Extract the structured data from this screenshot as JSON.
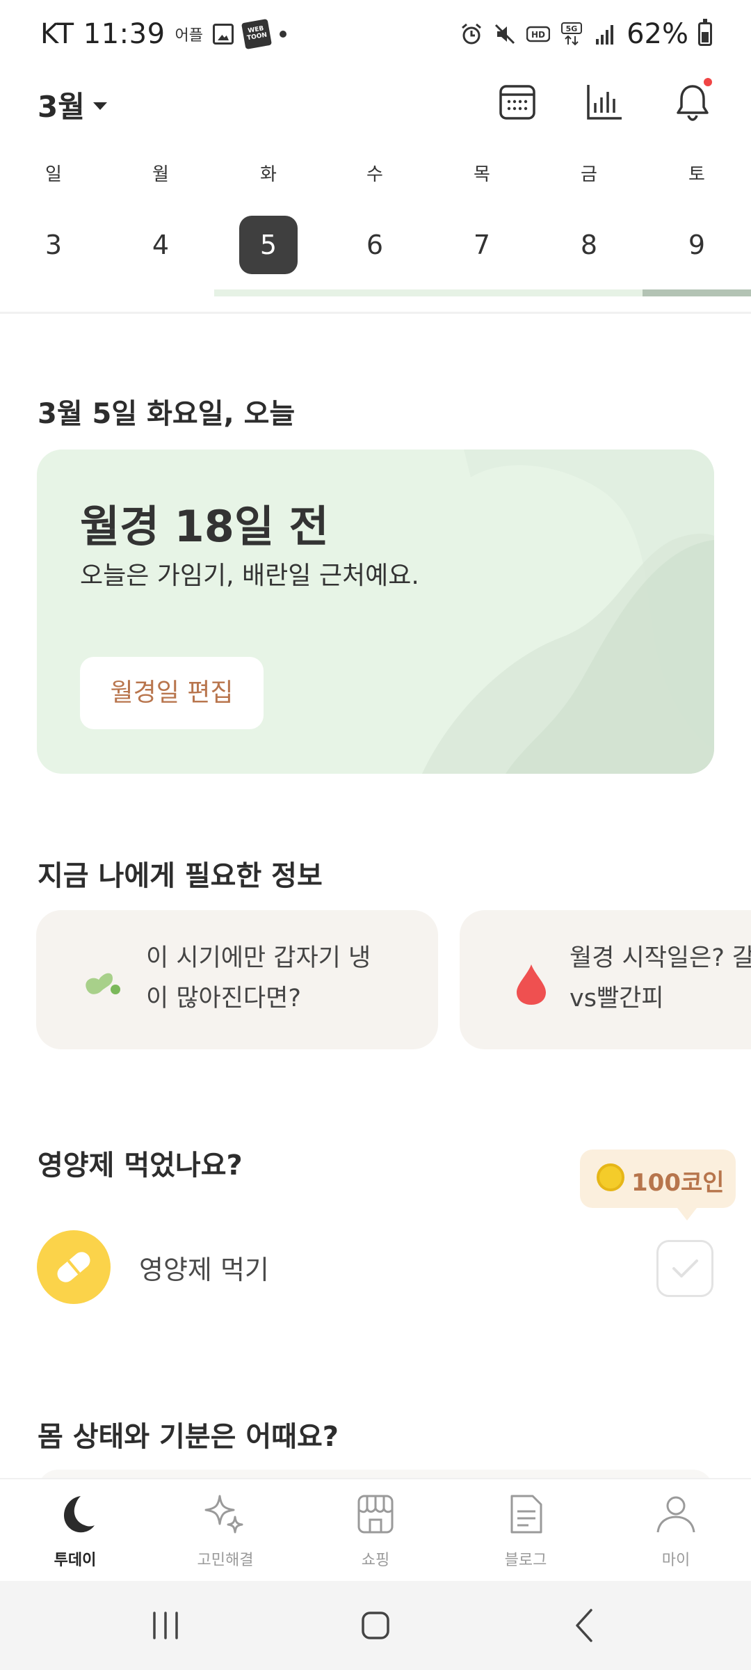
{
  "status_bar": {
    "carrier_time": "KT 11:39",
    "app_label": "어플",
    "webtoon_badge": "WEB TOON",
    "battery_percent": "62%"
  },
  "header": {
    "month_label": "3월"
  },
  "week": {
    "days": [
      {
        "dow": "일",
        "date": "3"
      },
      {
        "dow": "월",
        "date": "4"
      },
      {
        "dow": "화",
        "date": "5"
      },
      {
        "dow": "수",
        "date": "6"
      },
      {
        "dow": "목",
        "date": "7"
      },
      {
        "dow": "금",
        "date": "8"
      },
      {
        "dow": "토",
        "date": "9"
      }
    ],
    "selected_index": 2
  },
  "today": {
    "title": "3월 5일 화요일, 오늘",
    "card": {
      "headline": "월경 18일 전",
      "subtext": "오늘은 가임기, 배란일 근처예요.",
      "button_label": "월경일 편집"
    }
  },
  "info": {
    "title": "지금 나에게 필요한 정보",
    "cards": [
      {
        "text": "이 시기에만 갑자기 냉\n이 많아진다면?",
        "icon": "discharge-drops-icon"
      },
      {
        "text": "월경 시작일은? 갈\nvs빨간피",
        "icon": "blood-drop-icon"
      }
    ]
  },
  "supplement": {
    "title": "영양제 먹었나요?",
    "coin_reward": "100코인",
    "item_label": "영양제 먹기"
  },
  "mood": {
    "title": "몸 상태와 기분은 어때요?"
  },
  "bottom_nav": {
    "items": [
      {
        "label": "투데이",
        "icon": "moon-icon",
        "active": true
      },
      {
        "label": "고민해결",
        "icon": "sparkle-icon",
        "active": false
      },
      {
        "label": "쇼핑",
        "icon": "store-icon",
        "active": false
      },
      {
        "label": "블로그",
        "icon": "document-icon",
        "active": false
      },
      {
        "label": "마이",
        "icon": "person-icon",
        "active": false
      }
    ]
  },
  "colors": {
    "accent_green": "#e7f4e6",
    "button_text_brown": "#b8754d",
    "selected_day": "#3f3f3f",
    "pill_yellow": "#fbd34a",
    "notification_red": "#f04545"
  }
}
